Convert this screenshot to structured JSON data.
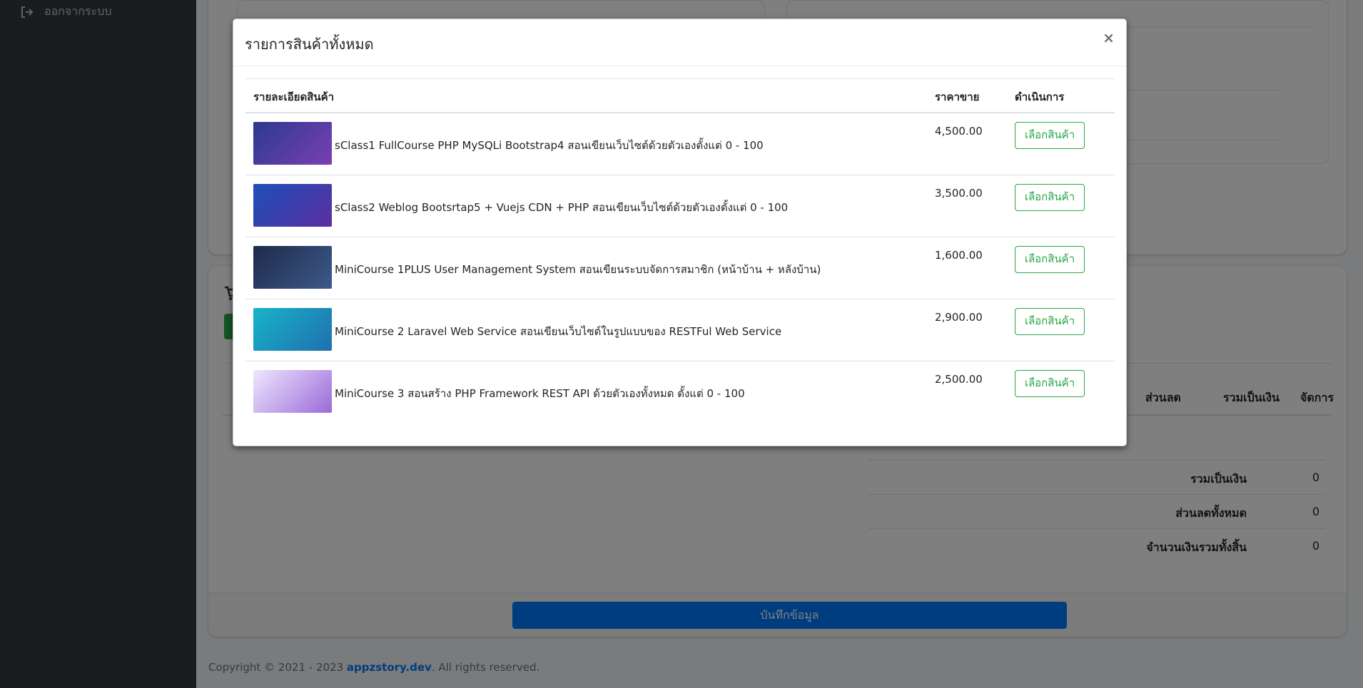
{
  "sidebar": {
    "logout_label": "ออกจากระบบ"
  },
  "background": {
    "table_headers": {
      "discount": "ส่วนลด",
      "total": "รวมเป็นเงิน",
      "manage": "จัดการ"
    },
    "summary": [
      {
        "label": "รวมเป็นเงิน",
        "value": "0"
      },
      {
        "label": "ส่วนลดทั้งหมด",
        "value": "0"
      },
      {
        "label": "จำนวนเงินรวมทั้งสิ้น",
        "value": "0"
      }
    ],
    "save_label": "บันทึกข้อมูล",
    "copyright_prefix": "Copyright © 2021 - 2023 ",
    "copyright_brand": "appzstory.dev",
    "copyright_suffix": ". All rights reserved."
  },
  "modal": {
    "title": "รายการสินค้าทั้งหมด",
    "close_symbol": "×",
    "headers": {
      "detail": "รายละเอียดสินค้า",
      "price": "ราคาขาย",
      "action": "ดำเนินการ"
    },
    "products": [
      {
        "name": "sClass1 FullCourse PHP MySQLi Bootstrap4 สอนเขียนเว็บไซต์ด้วยตัวเองตั้งแต่ 0 - 100",
        "price": "4,500.00",
        "button": "เลือกสินค้า",
        "thumb_colors": [
          "#2b3a8c",
          "#7a3fb5"
        ]
      },
      {
        "name": "sClass2 Weblog Bootsrtap5 + Vuejs CDN + PHP สอนเขียนเว็บไซต์ด้วยตัวเองตั้งแต่ 0 - 100",
        "price": "3,500.00",
        "button": "เลือกสินค้า",
        "thumb_colors": [
          "#1d4fb8",
          "#5b2fa0"
        ]
      },
      {
        "name": "MiniCourse 1PLUS User Management System สอนเขียนระบบจัดการสมาชิก (หน้าบ้าน + หลังบ้าน)",
        "price": "1,600.00",
        "button": "เลือกสินค้า",
        "thumb_colors": [
          "#1e2a4a",
          "#3d5a8a"
        ]
      },
      {
        "name": "MiniCourse 2 Laravel Web Service สอนเขียนเว็บไซต์ในรูปแบบของ RESTFul Web Service",
        "price": "2,900.00",
        "button": "เลือกสินค้า",
        "thumb_colors": [
          "#18b4c8",
          "#1f6fb0"
        ]
      },
      {
        "name": "MiniCourse 3 สอนสร้าง PHP Framework REST API ด้วยตัวเองทั้งหมด ตั้งแต่ 0 - 100",
        "price": "2,500.00",
        "button": "เลือกสินค้า",
        "thumb_colors": [
          "#f0e6ff",
          "#9a6bd8"
        ]
      }
    ]
  }
}
